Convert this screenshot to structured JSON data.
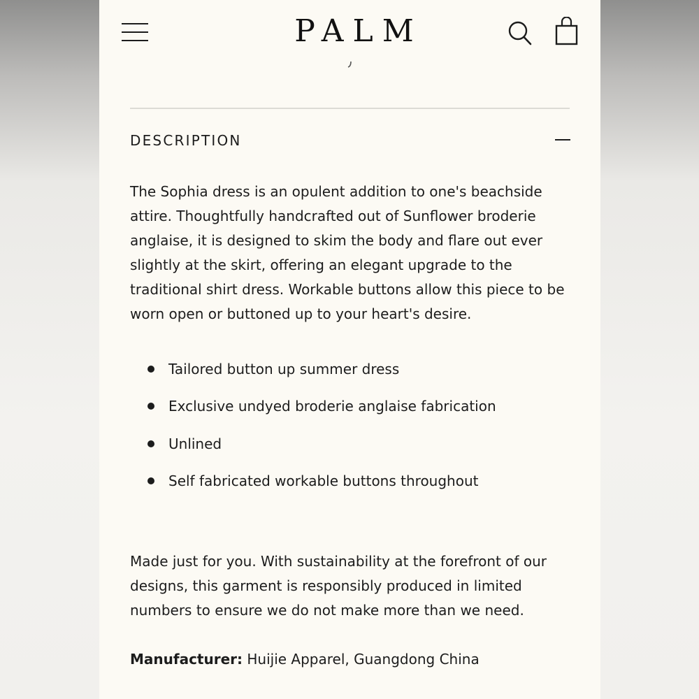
{
  "header": {
    "logo": "PALM",
    "menu_icon": "hamburger-menu-icon",
    "search_icon": "search-icon",
    "cart_icon": "shopping-bag-icon"
  },
  "description": {
    "title": "DESCRIPTION",
    "toggle_icon": "minus-collapse-icon",
    "body": "The Sophia dress is an opulent addition to one's beachside attire. Thoughtfully handcrafted out of Sunflower broderie anglaise, it is designed to skim the body and flare out ever slightly at the skirt, offering an elegant upgrade to the traditional shirt dress. Workable buttons allow this piece to be worn open or buttoned up to your heart's desire.",
    "features": [
      "Tailored button up summer dress",
      "Exclusive undyed broderie anglaise fabrication",
      "Unlined",
      "Self fabricated workable buttons throughout"
    ],
    "sustainability": "Made just for you. With sustainability at the forefront of our designs, this garment is responsibly produced in limited numbers to ensure we do not make more than we need.",
    "manufacturer_label": "Manufacturer:",
    "manufacturer_value": "Huijie Apparel, Guangdong China"
  },
  "colors": {
    "page_background": "#fcfaf4",
    "text": "#1c1c1c",
    "divider": "#dcdbd5"
  }
}
